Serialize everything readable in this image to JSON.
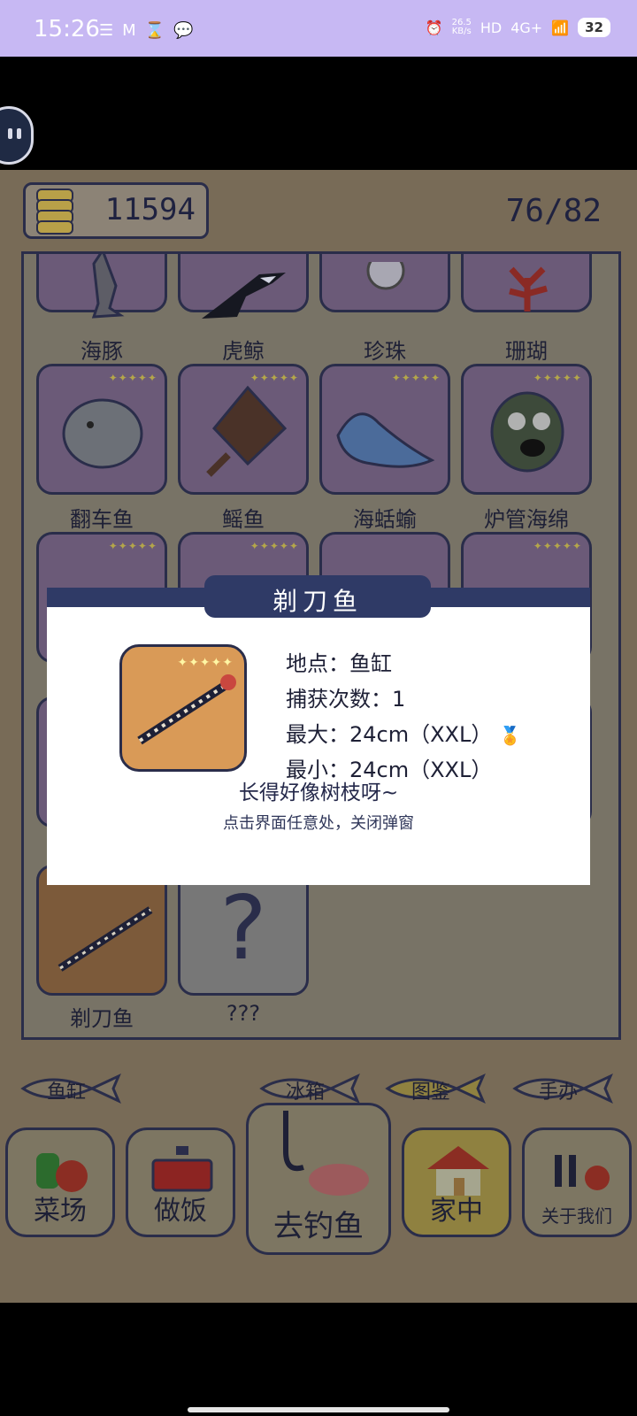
{
  "status_bar": {
    "time": "15:26",
    "speed_top": "26.5",
    "speed_bottom": "KB/s",
    "hd": "HD",
    "network": "4G+",
    "battery": "32"
  },
  "header": {
    "coins": "11594",
    "progress": "76/82"
  },
  "collection": {
    "row1": [
      "海豚",
      "虎鲸",
      "珍珠",
      "珊瑚"
    ],
    "row2": [
      "翻车鱼",
      "鳐鱼",
      "海蛞蝓",
      "炉管海绵"
    ],
    "row_last": [
      "剃刀鱼",
      "???"
    ],
    "stars": "✦✦✦✦✦",
    "unknown_symbol": "?"
  },
  "popup": {
    "title": "剃刀鱼",
    "stars": "✦✦✦✦✦",
    "location": "地点：鱼缸",
    "catches": "捕获次数：1",
    "max": "最大：24cm（XXL）",
    "min": "最小：24cm（XXL）",
    "description": "长得好像树枝呀~",
    "close_hint": "点击界面任意处，关闭弹窗"
  },
  "tabs": {
    "aquarium": "鱼缸",
    "fridge": "冰箱",
    "catalog": "图鉴",
    "figures": "手办"
  },
  "bottom_nav": {
    "farm": "菜场",
    "cook": "做饭",
    "fish": "去钓鱼",
    "home": "家中",
    "about": "关于我们"
  },
  "colors": {
    "panel_bg": "#787366",
    "cell_bg": "#6b5a78",
    "popup_header": "#2f3a66",
    "popup_fish_bg": "#d99a57",
    "status_bar": "#c7b8f3"
  }
}
